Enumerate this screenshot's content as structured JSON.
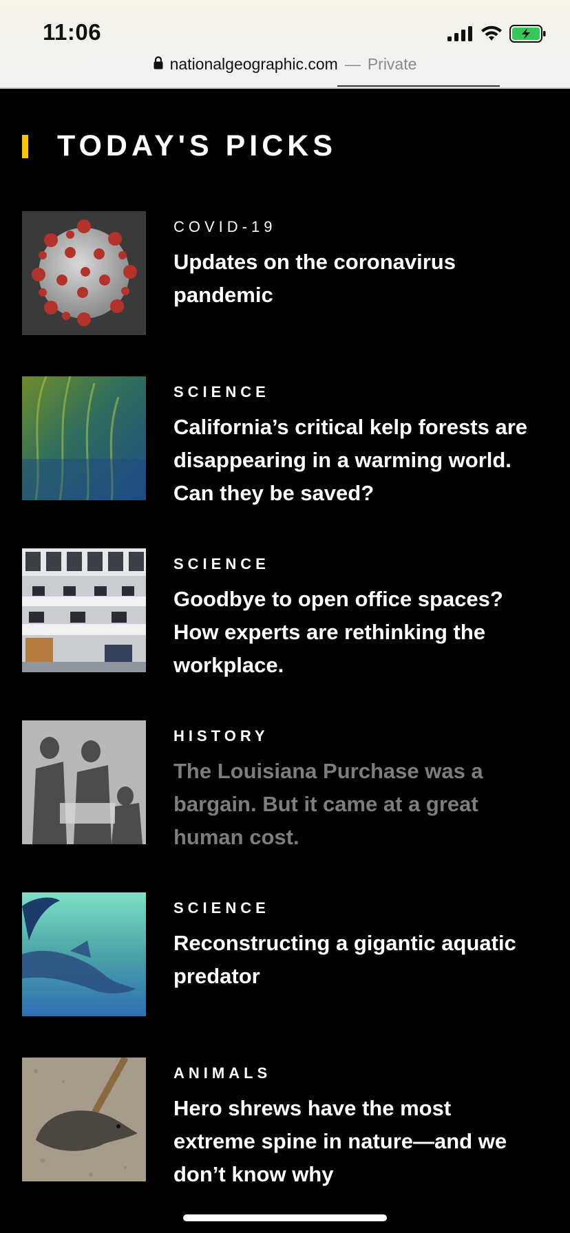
{
  "status_bar": {
    "time": "11:06",
    "signal_icon": "cellular-signal-icon",
    "wifi_icon": "wifi-icon",
    "battery_icon": "battery-charging-icon",
    "battery_color": "#34c759"
  },
  "url_bar": {
    "lock_icon": "lock-icon",
    "domain": "nationalgeographic.com",
    "separator": "—",
    "mode": "Private"
  },
  "section": {
    "title": "TODAY'S PICKS",
    "accent_color": "#f7c600"
  },
  "articles": [
    {
      "category": "COVID-19",
      "headline": "Updates on the coronavirus pandemic"
    },
    {
      "category": "SCIENCE",
      "headline": "California’s critical kelp forests are disappearing in a warming world. Can they be saved?"
    },
    {
      "category": "SCIENCE",
      "headline": "Goodbye to open office spaces? How experts are rethinking the workplace."
    },
    {
      "category": "HISTORY",
      "headline": "The Louisiana Purchase was a bargain. But it came at a great human cost."
    },
    {
      "category": "SCIENCE",
      "headline": "Reconstructing a gigantic aquatic predator"
    },
    {
      "category": "ANIMALS",
      "headline": "Hero shrews have the most extreme spine in nature—and we don’t know why"
    }
  ]
}
